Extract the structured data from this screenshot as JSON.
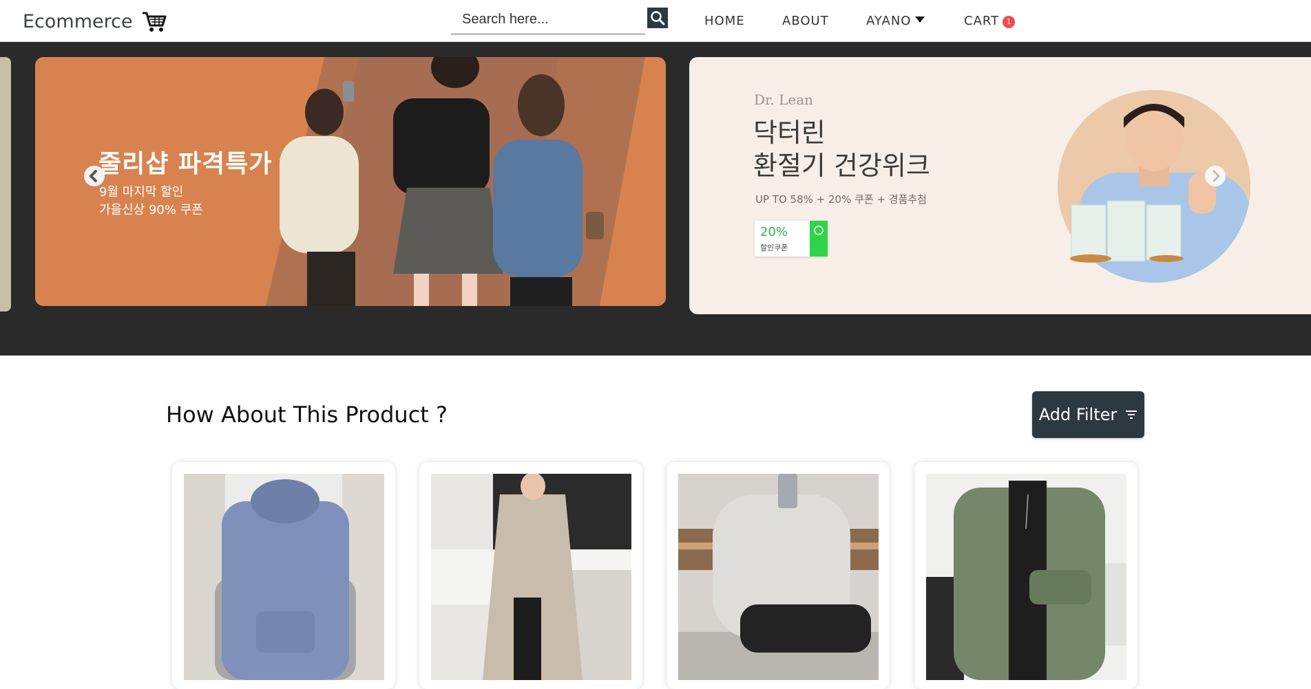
{
  "header": {
    "brand": "Ecommerce",
    "search": {
      "placeholder": "Search here..."
    },
    "nav": [
      {
        "label": "HOME"
      },
      {
        "label": "ABOUT"
      },
      {
        "label": "AYANO"
      },
      {
        "label": "CART",
        "badge": "1"
      }
    ]
  },
  "carousel": {
    "slides": [
      {
        "title": "줄리샵 파격특가",
        "subtitle_lines": [
          "9월 마지막 할인",
          "가을신상 90% 쿠폰"
        ]
      },
      {
        "brand": "Dr. Lean",
        "title_lines": [
          "닥터린",
          "환절기 건강위크"
        ],
        "tagline": "UP TO 58% + 20% 쿠폰 + 경품추첨",
        "coupon_percent": "20%",
        "coupon_label": "할인쿠폰"
      }
    ]
  },
  "products_section": {
    "title": "How About This Product ?",
    "filter_label": "Add Filter"
  },
  "products": [
    {
      "name": "blue-hoodie"
    },
    {
      "name": "beige-trench-coat"
    },
    {
      "name": "grey-hoodie"
    },
    {
      "name": "olive-field-jacket"
    }
  ],
  "colors": {
    "header_bg": "#ffffff",
    "carousel_bg": "#2a2a2a",
    "accent_dark": "#2d3941",
    "slide1_bg": "#d8834f",
    "slide2_bg": "#f6eee7",
    "badge": "#f14b4b"
  }
}
